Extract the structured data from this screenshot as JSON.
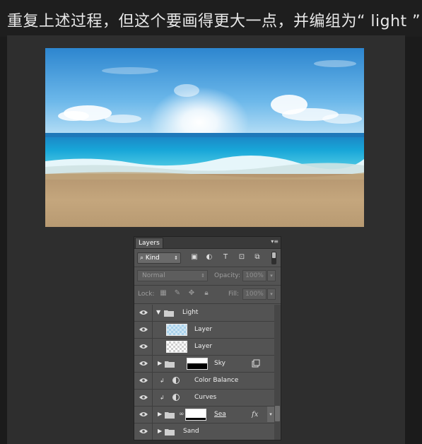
{
  "caption": {
    "text": "重复上述过程，但这个要画得更大一点，并编组为“ light ”"
  },
  "photo": {
    "alt": "beach-sky-sea-image"
  },
  "layers_panel": {
    "tab_label": "Layers",
    "menu_icon": "panel-menu-icon",
    "filter": {
      "kind_label": "Kind",
      "icons": [
        "image-filter-icon",
        "adjustment-filter-icon",
        "type-filter-icon",
        "shape-filter-icon",
        "smart-object-filter-icon"
      ]
    },
    "blend_mode": "Normal",
    "opacity_label": "Opacity:",
    "opacity_value": "100%",
    "lock_label": "Lock:",
    "fill_label": "Fill:",
    "fill_value": "100%",
    "layers": [
      {
        "name": "Light",
        "type": "group",
        "expanded": true
      },
      {
        "name": "Layer",
        "type": "pixel",
        "indent": true,
        "thumb": "blue"
      },
      {
        "name": "Layer",
        "type": "pixel",
        "indent": true,
        "thumb": "transparent"
      },
      {
        "name": "Sky",
        "type": "group",
        "expanded": false,
        "mask": "sky"
      },
      {
        "name": "Color Balance",
        "type": "adjustment",
        "clipped": true
      },
      {
        "name": "Curves",
        "type": "adjustment",
        "clipped": true
      },
      {
        "name": "Sea",
        "type": "group",
        "expanded": false,
        "mask": "sea",
        "fx": "fx"
      },
      {
        "name": "Sand",
        "type": "group",
        "expanded": false
      }
    ]
  }
}
